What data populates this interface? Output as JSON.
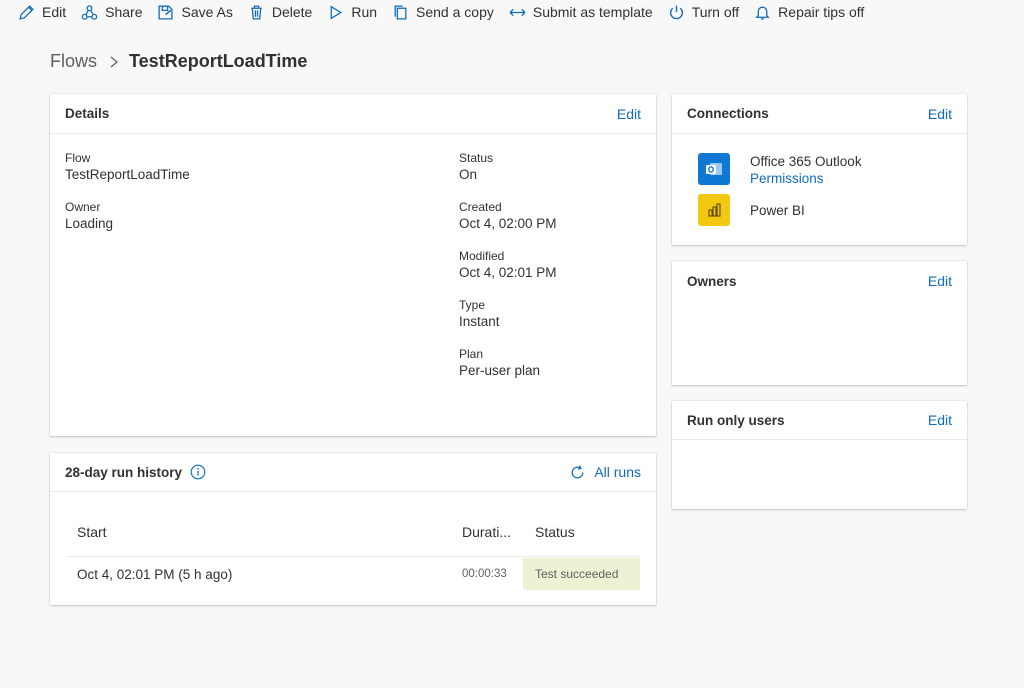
{
  "toolbar": {
    "edit": "Edit",
    "share": "Share",
    "save_as": "Save As",
    "delete": "Delete",
    "run": "Run",
    "send_copy": "Send a copy",
    "submit_template": "Submit as template",
    "turn_off": "Turn off",
    "repair_tips": "Repair tips off"
  },
  "breadcrumb": {
    "root": "Flows",
    "current": "TestReportLoadTime"
  },
  "details": {
    "title": "Details",
    "edit": "Edit",
    "flow_label": "Flow",
    "flow_value": "TestReportLoadTime",
    "owner_label": "Owner",
    "owner_value": "Loading",
    "status_label": "Status",
    "status_value": "On",
    "created_label": "Created",
    "created_value": "Oct 4, 02:00 PM",
    "modified_label": "Modified",
    "modified_value": "Oct 4, 02:01 PM",
    "type_label": "Type",
    "type_value": "Instant",
    "plan_label": "Plan",
    "plan_value": "Per-user plan"
  },
  "connections": {
    "title": "Connections",
    "edit": "Edit",
    "items": [
      {
        "name": "Office 365 Outlook",
        "permissions": "Permissions",
        "icon": "outlook-icon",
        "color": "#0f78d4"
      },
      {
        "name": "Power BI",
        "icon": "powerbi-icon",
        "color": "#f2c811"
      }
    ]
  },
  "owners": {
    "title": "Owners",
    "edit": "Edit"
  },
  "run_only": {
    "title": "Run only users",
    "edit": "Edit"
  },
  "run_history": {
    "title": "28-day run history",
    "all_runs": "All runs",
    "columns": {
      "start": "Start",
      "duration": "Durati...",
      "status": "Status"
    },
    "rows": [
      {
        "start": "Oct 4, 02:01 PM (5 h ago)",
        "duration": "00:00:33",
        "status": "Test succeeded"
      }
    ]
  },
  "colors": {
    "accent": "#0f6cbd",
    "success_bg": "#eef2d5"
  }
}
